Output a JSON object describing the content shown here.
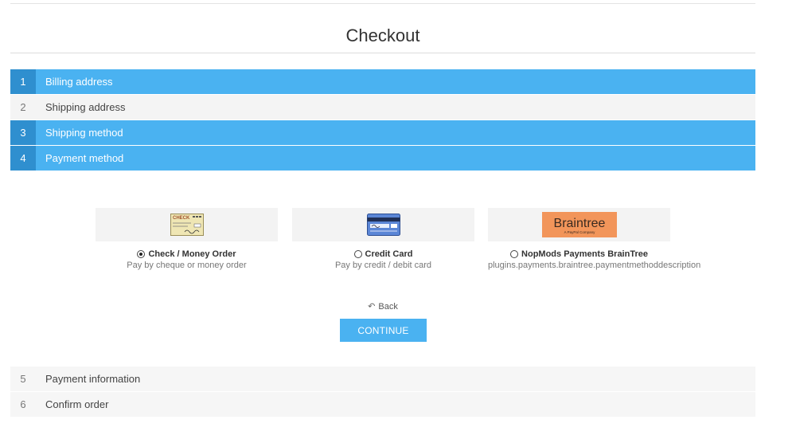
{
  "page": {
    "title": "Checkout"
  },
  "steps": [
    {
      "num": "1",
      "label": "Billing address"
    },
    {
      "num": "2",
      "label": "Shipping address"
    },
    {
      "num": "3",
      "label": "Shipping method"
    },
    {
      "num": "4",
      "label": "Payment method"
    },
    {
      "num": "5",
      "label": "Payment information"
    },
    {
      "num": "6",
      "label": "Confirm order"
    }
  ],
  "payment_methods": [
    {
      "name": "Check / Money Order",
      "description": "Pay by cheque or money order",
      "selected": true,
      "icon": "check-image",
      "image_text": "CHECK"
    },
    {
      "name": "Credit Card",
      "description": "Pay by credit / debit card",
      "selected": false,
      "icon": "credit-card-image"
    },
    {
      "name": "NopMods Payments BrainTree",
      "description": "plugins.payments.braintree.paymentmethoddescription",
      "selected": false,
      "icon": "braintree-logo",
      "logo_text": "Braintree",
      "logo_subtext": "A PayPal Company"
    }
  ],
  "actions": {
    "back_label": "Back",
    "continue_label": "CONTINUE"
  },
  "colors": {
    "accent": "#4ab2f1",
    "accent_dark": "#2f8fcf",
    "inactive_bg": "#f4f4f4",
    "braintree_orange": "#f2955a"
  }
}
